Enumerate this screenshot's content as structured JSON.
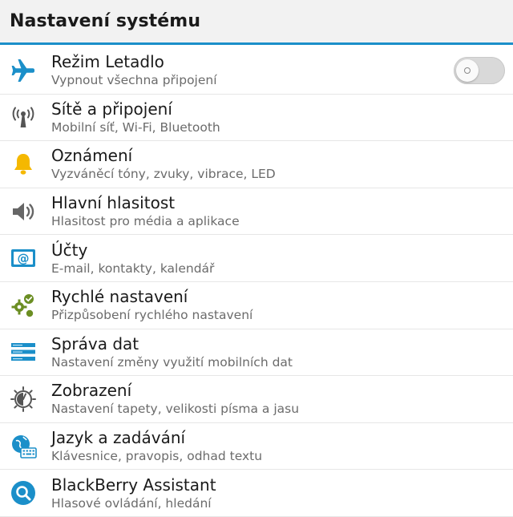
{
  "header": {
    "title": "Nastavení systému"
  },
  "colors": {
    "accent": "#1b8fc9",
    "text": "#1a1a1a",
    "secondary": "#6b6b6b"
  },
  "items": [
    {
      "id": "airplane",
      "icon": "airplane-icon",
      "title": "Režim Letadlo",
      "subtitle": "Vypnout všechna připojení",
      "toggle_on": false
    },
    {
      "id": "networks",
      "icon": "antenna-icon",
      "title": "Sítě a připojení",
      "subtitle": "Mobilní síť, Wi-Fi, Bluetooth"
    },
    {
      "id": "notifications",
      "icon": "bell-icon",
      "title": "Oznámení",
      "subtitle": "Vyzváněcí tóny, zvuky, vibrace, LED"
    },
    {
      "id": "volume",
      "icon": "speaker-icon",
      "title": "Hlavní hlasitost",
      "subtitle": "Hlasitost pro média a aplikace"
    },
    {
      "id": "accounts",
      "icon": "email-at-icon",
      "title": "Účty",
      "subtitle": "E-mail, kontakty, kalendář"
    },
    {
      "id": "quick-settings",
      "icon": "gears-check-icon",
      "title": "Rychlé nastavení",
      "subtitle": "Přizpůsobení rychlého nastavení"
    },
    {
      "id": "data",
      "icon": "data-stack-icon",
      "title": "Správa dat",
      "subtitle": "Nastavení změny využití mobilních dat"
    },
    {
      "id": "display",
      "icon": "display-brightness-icon",
      "title": "Zobrazení",
      "subtitle": "Nastavení tapety, velikosti písma a jasu"
    },
    {
      "id": "language",
      "icon": "globe-keyboard-icon",
      "title": "Jazyk a zadávání",
      "subtitle": "Klávesnice, pravopis, odhad textu"
    },
    {
      "id": "assistant",
      "icon": "assistant-search-icon",
      "title": "BlackBerry Assistant",
      "subtitle": "Hlasové ovládání, hledání"
    }
  ]
}
